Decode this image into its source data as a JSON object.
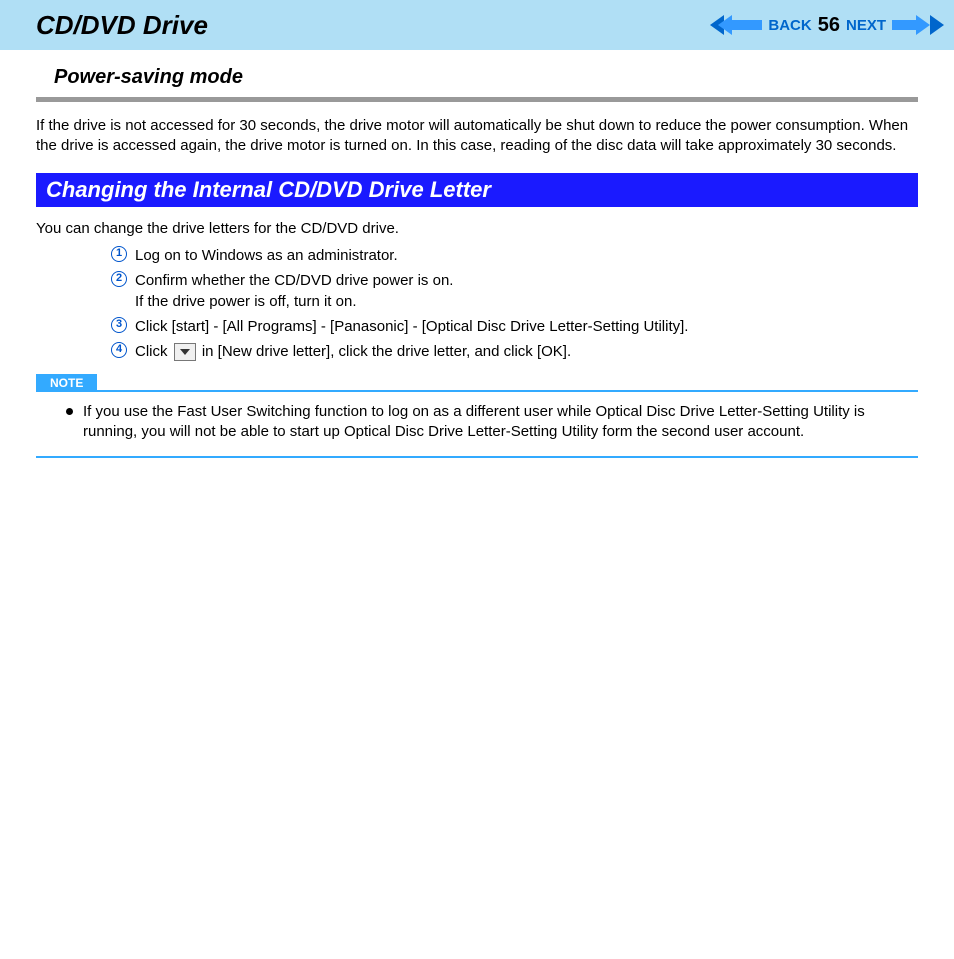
{
  "header": {
    "title": "CD/DVD Drive",
    "back_label": "BACK",
    "page_number": "56",
    "next_label": "NEXT"
  },
  "subheading": "Power-saving mode",
  "intro_paragraph": "If the drive is not accessed for 30 seconds, the drive motor will automatically be shut down to reduce the power consumption. When the drive is accessed again, the drive motor is turned on. In this case, reading of the disc data will take approximately 30 seconds.",
  "section_heading": "Changing the Internal CD/DVD Drive Letter",
  "section_intro": "You can change the drive letters for the CD/DVD drive.",
  "steps": {
    "s1": "Log on to Windows as an administrator.",
    "s2a": "Confirm whether the CD/DVD drive power is on.",
    "s2b": "If the drive power is off, turn it on.",
    "s3": "Click [start] - [All Programs] - [Panasonic] - [Optical Disc Drive Letter-Setting Utility].",
    "s4_pre": "Click ",
    "s4_post": " in [New drive letter], click the drive letter, and click [OK]."
  },
  "note": {
    "label": "NOTE",
    "text": "If you use the Fast User Switching function to log on as a different user while Optical Disc Drive Letter-Setting Utility is running, you will not be able to start up Optical Disc Drive Letter-Setting Utility form the second user account."
  },
  "circled_numbers": {
    "n1": "1",
    "n2": "2",
    "n3": "3",
    "n4": "4"
  }
}
